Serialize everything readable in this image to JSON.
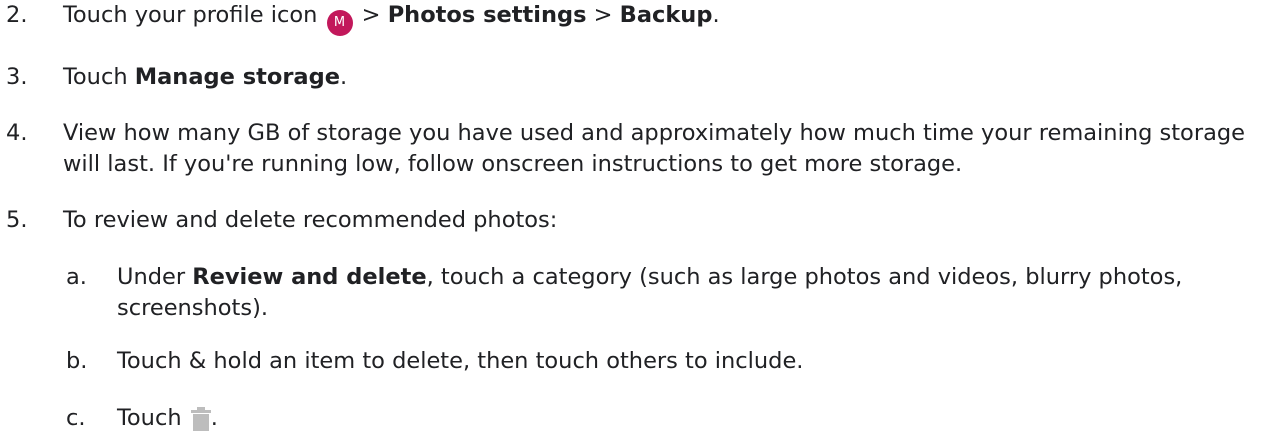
{
  "steps": [
    {
      "num": "2.",
      "parts": {
        "t1": "Touch your profile icon",
        "avatar_letter": "M",
        "sep1": ">",
        "b1": "Photos settings",
        "sep2": ">",
        "b2": "Backup",
        "end": "."
      }
    },
    {
      "num": "3.",
      "parts": {
        "t1": "Touch",
        "b1": "Manage storage",
        "end": "."
      }
    },
    {
      "num": "4.",
      "text": "View how many GB of storage you have used and approximately how much time your remaining storage will last. If you're running low, follow onscreen instructions to get more storage."
    },
    {
      "num": "5.",
      "text": "To review and delete recommended photos:"
    }
  ],
  "substeps": [
    {
      "num": "a.",
      "parts": {
        "t1": "Under",
        "b1": "Review and delete",
        "t2": ", touch a category (such as large photos and videos, blurry photos, screenshots)."
      }
    },
    {
      "num": "b.",
      "text": "Touch & hold an item to delete, then touch others to include."
    },
    {
      "num": "c.",
      "parts": {
        "t1": "Touch",
        "icon": "trash-icon",
        "end": "."
      }
    }
  ],
  "colors": {
    "text": "#202124",
    "avatar_bg": "#c2185b",
    "icon_gray": "#bdbdbd"
  }
}
